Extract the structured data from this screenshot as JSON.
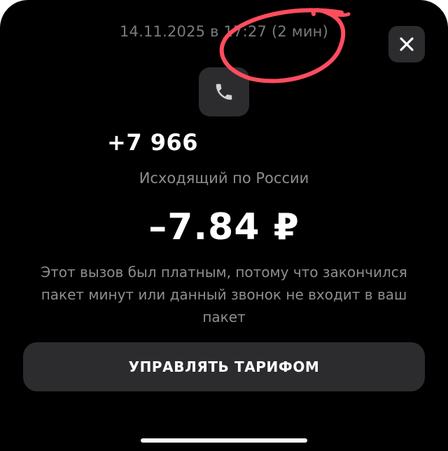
{
  "header": {
    "timestamp": "14.11.2025 в 17:27 (2 мин)"
  },
  "close_button": {
    "icon": "close-icon"
  },
  "call": {
    "icon": "phone-icon",
    "phone_number": "+7 966",
    "type": "Исходящий по России",
    "amount": "–7.84 ₽",
    "description": "Этот вызов был платным, потому что закончился пакет минут или данный звонок не входит в ваш пакет"
  },
  "actions": {
    "manage_tariff_label": "УПРАВЛЯТЬ ТАРИФОМ"
  },
  "colors": {
    "background": "#000000",
    "surface": "#2c2c2e",
    "secondary_text": "#8e8e93",
    "annotation_circle": "#ff4d5e"
  }
}
